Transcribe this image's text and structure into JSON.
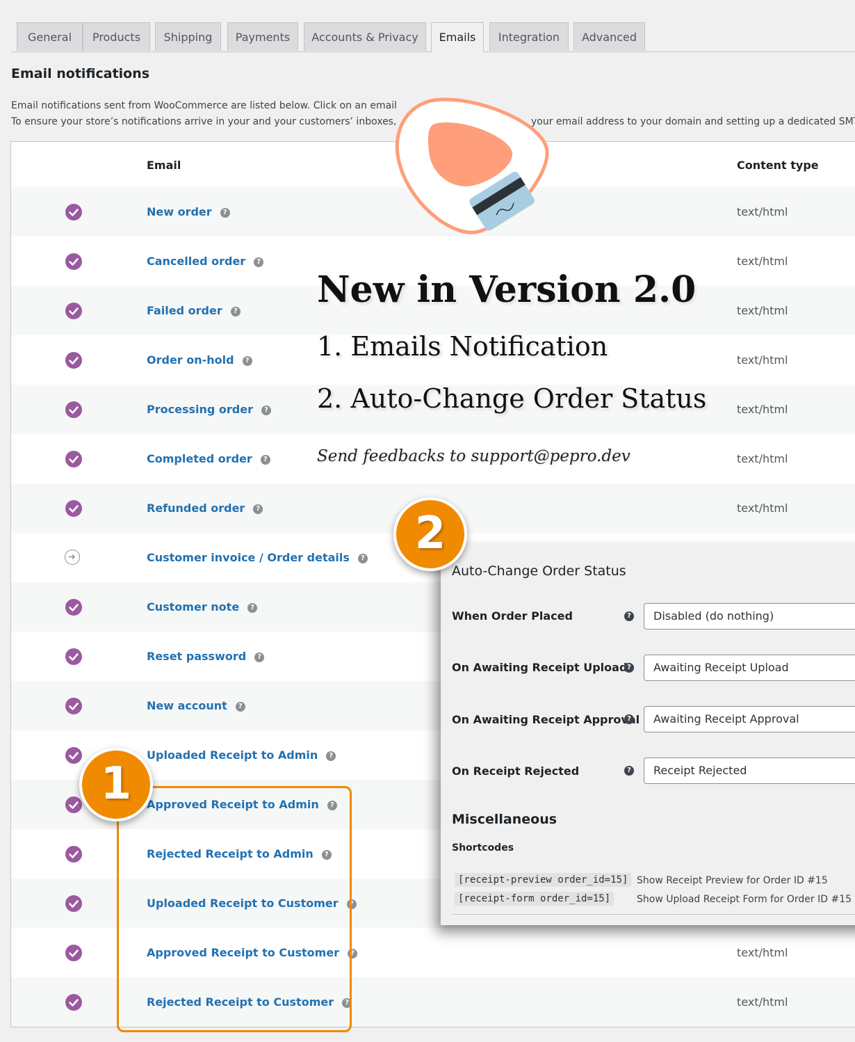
{
  "tabs": [
    "General",
    "Products",
    "Shipping",
    "Payments",
    "Accounts & Privacy",
    "Emails",
    "Integration",
    "Advanced"
  ],
  "active_tab": "Emails",
  "section_title": "Email notifications",
  "description_line1": "Email notifications sent from WooCommerce are listed below. Click on an email",
  "description_line2_left": "To ensure your store’s notifications arrive in your and your customers’ inboxes,",
  "description_line2_right": "your email address to your domain and setting up a dedicated SMT",
  "table": {
    "col_email": "Email",
    "col_content_type": "Content type",
    "rows": [
      {
        "name": "New order",
        "status": "enabled",
        "content_type": "text/html"
      },
      {
        "name": "Cancelled order",
        "status": "enabled",
        "content_type": "text/html"
      },
      {
        "name": "Failed order",
        "status": "enabled",
        "content_type": "text/html"
      },
      {
        "name": "Order on-hold",
        "status": "enabled",
        "content_type": "text/html"
      },
      {
        "name": "Processing order",
        "status": "enabled",
        "content_type": "text/html"
      },
      {
        "name": "Completed order",
        "status": "enabled",
        "content_type": "text/html"
      },
      {
        "name": "Refunded order",
        "status": "enabled",
        "content_type": "text/html"
      },
      {
        "name": "Customer invoice / Order details",
        "status": "manual",
        "content_type": ""
      },
      {
        "name": "Customer note",
        "status": "enabled",
        "content_type": ""
      },
      {
        "name": "Reset password",
        "status": "enabled",
        "content_type": ""
      },
      {
        "name": "New account",
        "status": "enabled",
        "content_type": ""
      },
      {
        "name": "Uploaded Receipt to Admin",
        "status": "enabled",
        "content_type": ""
      },
      {
        "name": "Approved Receipt to Admin",
        "status": "enabled",
        "content_type": ""
      },
      {
        "name": "Rejected Receipt to Admin",
        "status": "enabled",
        "content_type": ""
      },
      {
        "name": "Uploaded Receipt to Customer",
        "status": "enabled",
        "content_type": ""
      },
      {
        "name": "Approved Receipt to Customer",
        "status": "enabled",
        "content_type": "text/html"
      },
      {
        "name": "Rejected Receipt to Customer",
        "status": "enabled",
        "content_type": "text/html"
      }
    ]
  },
  "promo": {
    "title": "New in Version 2.0",
    "item1": "1. Emails Notification",
    "item2": "2. Auto-Change Order Status",
    "feedback": "Send feedbacks to support@pepro.dev"
  },
  "badges": {
    "one": "1",
    "two": "2"
  },
  "auto_change": {
    "title": "Auto-Change Order Status",
    "fields": [
      {
        "label": "When Order Placed",
        "value": "Disabled (do nothing)"
      },
      {
        "label": "On Awaiting Receipt Upload",
        "value": "Awaiting Receipt Upload"
      },
      {
        "label": "On Awaiting Receipt Approval",
        "value": "Awaiting Receipt Approval"
      },
      {
        "label": "On Receipt Rejected",
        "value": "Receipt Rejected"
      }
    ],
    "misc_title": "Miscellaneous",
    "shortcodes_label": "Shortcodes",
    "shortcodes": [
      {
        "code": "[receipt-preview order_id=15]",
        "desc": "Show Receipt Preview for Order ID #15"
      },
      {
        "code": "[receipt-form order_id=15]",
        "desc": "Show Upload Receipt Form for Order ID #15"
      }
    ]
  },
  "colors": {
    "accent": "#f08a00",
    "link": "#2271b1",
    "check": "#9b59a0",
    "logo": "#ff9e7a"
  },
  "icons": {
    "enabled": "check-circle-icon",
    "manual": "arrow-circle-icon",
    "help": "help-icon",
    "logo": "receipt-logo-icon"
  }
}
